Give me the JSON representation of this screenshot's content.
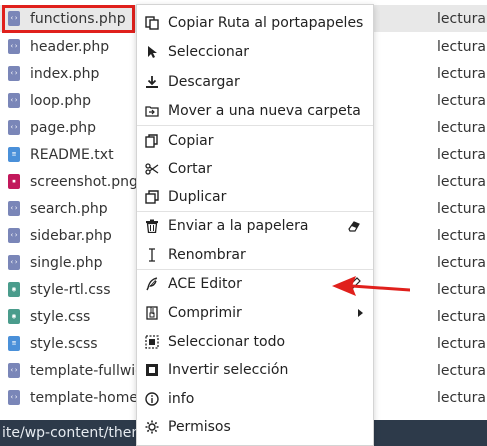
{
  "files": [
    {
      "name": "functions.php",
      "type": "php",
      "perm": "lectura",
      "selected": true
    },
    {
      "name": "header.php",
      "type": "php",
      "perm": "lectura"
    },
    {
      "name": "index.php",
      "type": "php",
      "perm": "lectura"
    },
    {
      "name": "loop.php",
      "type": "php",
      "perm": "lectura"
    },
    {
      "name": "page.php",
      "type": "php",
      "perm": "lectura"
    },
    {
      "name": "README.txt",
      "type": "txt",
      "perm": "lectura"
    },
    {
      "name": "screenshot.png",
      "type": "img",
      "perm": "lectura"
    },
    {
      "name": "search.php",
      "type": "php",
      "perm": "lectura"
    },
    {
      "name": "sidebar.php",
      "type": "php",
      "perm": "lectura"
    },
    {
      "name": "single.php",
      "type": "php",
      "perm": "lectura"
    },
    {
      "name": "style-rtl.css",
      "type": "css",
      "perm": "lectura"
    },
    {
      "name": "style.css",
      "type": "css",
      "perm": "lectura"
    },
    {
      "name": "style.scss",
      "type": "scss",
      "perm": "lectura"
    },
    {
      "name": "template-fullwidth.php",
      "type": "php",
      "perm": "lectura"
    },
    {
      "name": "template-homepage.php",
      "type": "php",
      "perm": "lectura"
    }
  ],
  "status_bar": {
    "path": "ite/wp-content/themes"
  },
  "context_menu": {
    "items": [
      {
        "label": "Copiar Ruta al portapapeles",
        "icon": "copy-path-icon"
      },
      {
        "label": "Seleccionar",
        "icon": "cursor-icon"
      },
      {
        "label": "Descargar",
        "icon": "download-icon"
      },
      {
        "label": "Mover a una nueva carpeta",
        "icon": "move-folder-icon"
      },
      {
        "label": "Copiar",
        "icon": "copy-icon"
      },
      {
        "label": "Cortar",
        "icon": "scissors-icon"
      },
      {
        "label": "Duplicar",
        "icon": "duplicate-icon"
      },
      {
        "label": "Enviar a la papelera",
        "icon": "trash-icon",
        "shortcut_icon": "eraser-icon"
      },
      {
        "label": "Renombrar",
        "icon": "text-cursor-icon"
      },
      {
        "label": "ACE Editor",
        "icon": "feather-icon",
        "shortcut_icon": "edit-shortcut-icon"
      },
      {
        "label": "Comprimir",
        "icon": "archive-icon",
        "submenu": true
      },
      {
        "label": "Seleccionar todo",
        "icon": "select-all-icon"
      },
      {
        "label": "Invertir selección",
        "icon": "invert-selection-icon"
      },
      {
        "label": "info",
        "icon": "info-icon"
      },
      {
        "label": "Permisos",
        "icon": "gear-icon"
      }
    ]
  },
  "colors": {
    "php": "#7a86b8",
    "txt": "#4a90d9",
    "img": "#c2185b",
    "css": "#4a9c8c",
    "scss": "#4a90d9",
    "highlight": "#e0201c",
    "status_bar": "#2d3a4a"
  }
}
